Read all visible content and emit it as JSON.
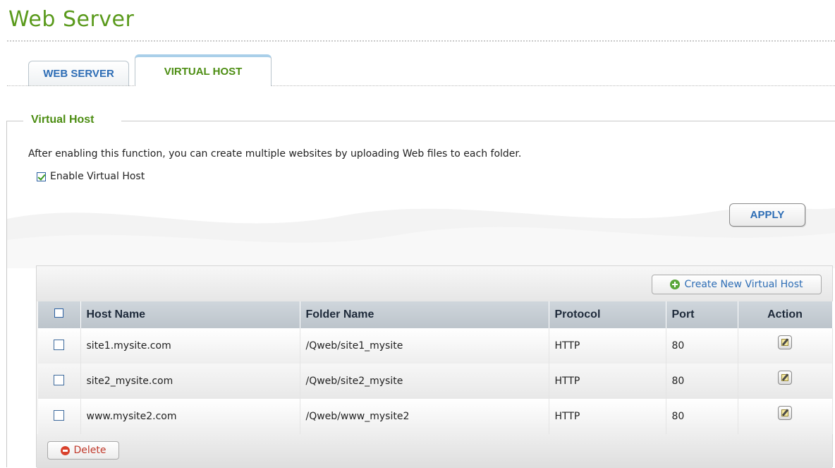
{
  "page": {
    "title": "Web Server"
  },
  "tabs": [
    {
      "label": "WEB SERVER",
      "active": false
    },
    {
      "label": "VIRTUAL HOST",
      "active": true
    }
  ],
  "section": {
    "title": "Virtual Host",
    "description": "After enabling this function, you can create multiple websites by uploading Web files to each folder.",
    "enable_label": "Enable Virtual Host",
    "enable_checked": true,
    "apply_label": "APPLY"
  },
  "grid": {
    "create_label": "Create New Virtual Host",
    "delete_label": "Delete",
    "columns": [
      "Host Name",
      "Folder Name",
      "Protocol",
      "Port",
      "Action"
    ],
    "rows": [
      {
        "host": "site1.mysite.com",
        "folder": "/Qweb/site1_mysite",
        "protocol": "HTTP",
        "port": "80"
      },
      {
        "host": "site2_mysite.com",
        "folder": "/Qweb/site2_mysite",
        "protocol": "HTTP",
        "port": "80"
      },
      {
        "host": "www.mysite2.com",
        "folder": "/Qweb/www_mysite2",
        "protocol": "HTTP",
        "port": "80"
      }
    ]
  },
  "colors": {
    "title_green": "#5a9a1c",
    "tab_blue": "#2d6db5",
    "header_bg": "#c6cdd3",
    "delete_red": "#d9412c",
    "add_green": "#5aa63a"
  },
  "icons": {
    "checkbox": "checkbox-icon",
    "add": "plus-circle-icon",
    "delete": "minus-circle-icon",
    "edit": "edit-icon"
  }
}
